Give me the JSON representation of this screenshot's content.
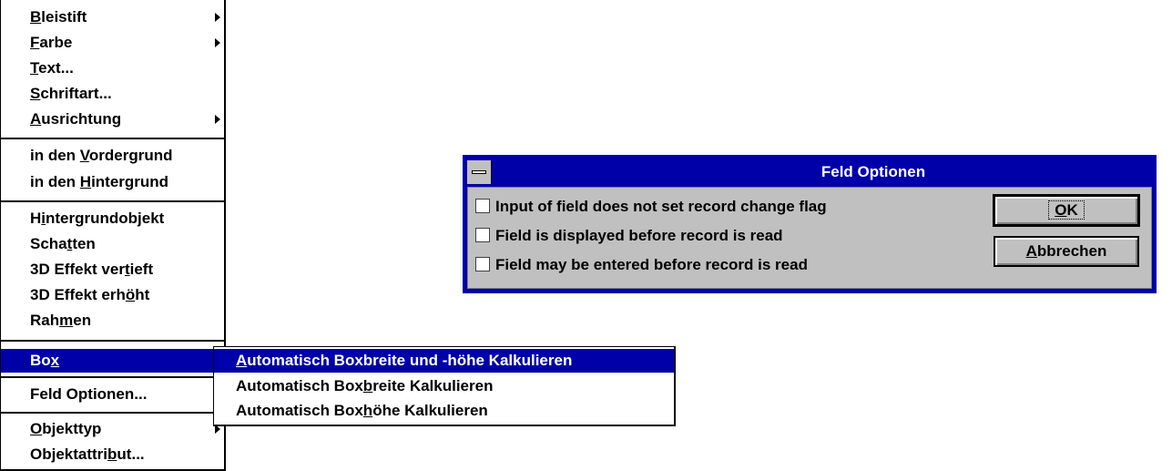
{
  "menu": {
    "items": [
      {
        "pre": "",
        "u": "B",
        "post": "leistift",
        "submenu": true
      },
      {
        "pre": "",
        "u": "F",
        "post": "arbe",
        "submenu": true
      },
      {
        "pre": "",
        "u": "T",
        "post": "ext...",
        "submenu": false
      },
      {
        "pre": "",
        "u": "S",
        "post": "chriftart...",
        "submenu": false
      },
      {
        "pre": "",
        "u": "A",
        "post": "usrichtung",
        "submenu": true
      },
      {
        "pre": "in den ",
        "u": "V",
        "post": "ordergrund",
        "submenu": false
      },
      {
        "pre": "in den ",
        "u": "H",
        "post": "intergrund",
        "submenu": false
      },
      {
        "pre": "H",
        "u": "i",
        "post": "ntergrundobjekt",
        "submenu": false
      },
      {
        "pre": "Scha",
        "u": "t",
        "post": "ten",
        "submenu": false
      },
      {
        "pre": "3D Effekt ver",
        "u": "t",
        "post": "ieft",
        "submenu": false
      },
      {
        "pre": "3D Effekt erh",
        "u": "ö",
        "post": "ht",
        "submenu": false
      },
      {
        "pre": "Rah",
        "u": "m",
        "post": "en",
        "submenu": false
      },
      {
        "pre": "Bo",
        "u": "x",
        "post": "",
        "submenu": false,
        "selected": true
      },
      {
        "pre": "Feld Optionen...",
        "u": "",
        "post": "",
        "submenu": false
      },
      {
        "pre": "",
        "u": "O",
        "post": "bjekttyp",
        "submenu": true
      },
      {
        "pre": "Objektattri",
        "u": "b",
        "post": "ut...",
        "submenu": false
      }
    ]
  },
  "submenu": {
    "items": [
      {
        "pre": "",
        "u": "A",
        "post": "utomatisch Boxbreite und -höhe Kalkulieren",
        "selected": true
      },
      {
        "pre": "Automatisch Box",
        "u": "b",
        "post": "reite Kalkulieren",
        "selected": false
      },
      {
        "pre": "Automatisch Box",
        "u": "h",
        "post": "öhe Kalkulieren",
        "selected": false
      }
    ]
  },
  "dialog": {
    "title": "Feld Optionen",
    "checkboxes": [
      {
        "label": "Input of field does not set record change flag",
        "checked": false
      },
      {
        "label": "Field is displayed before record is read",
        "checked": false
      },
      {
        "label": "Field may be entered before record is read",
        "checked": false
      }
    ],
    "ok": {
      "pre": "",
      "u": "O",
      "post": "K"
    },
    "cancel": {
      "pre": "",
      "u": "A",
      "post": "bbrechen"
    }
  },
  "colors": {
    "selection": "#0000a8",
    "dialog_face": "#c0c0c0"
  }
}
